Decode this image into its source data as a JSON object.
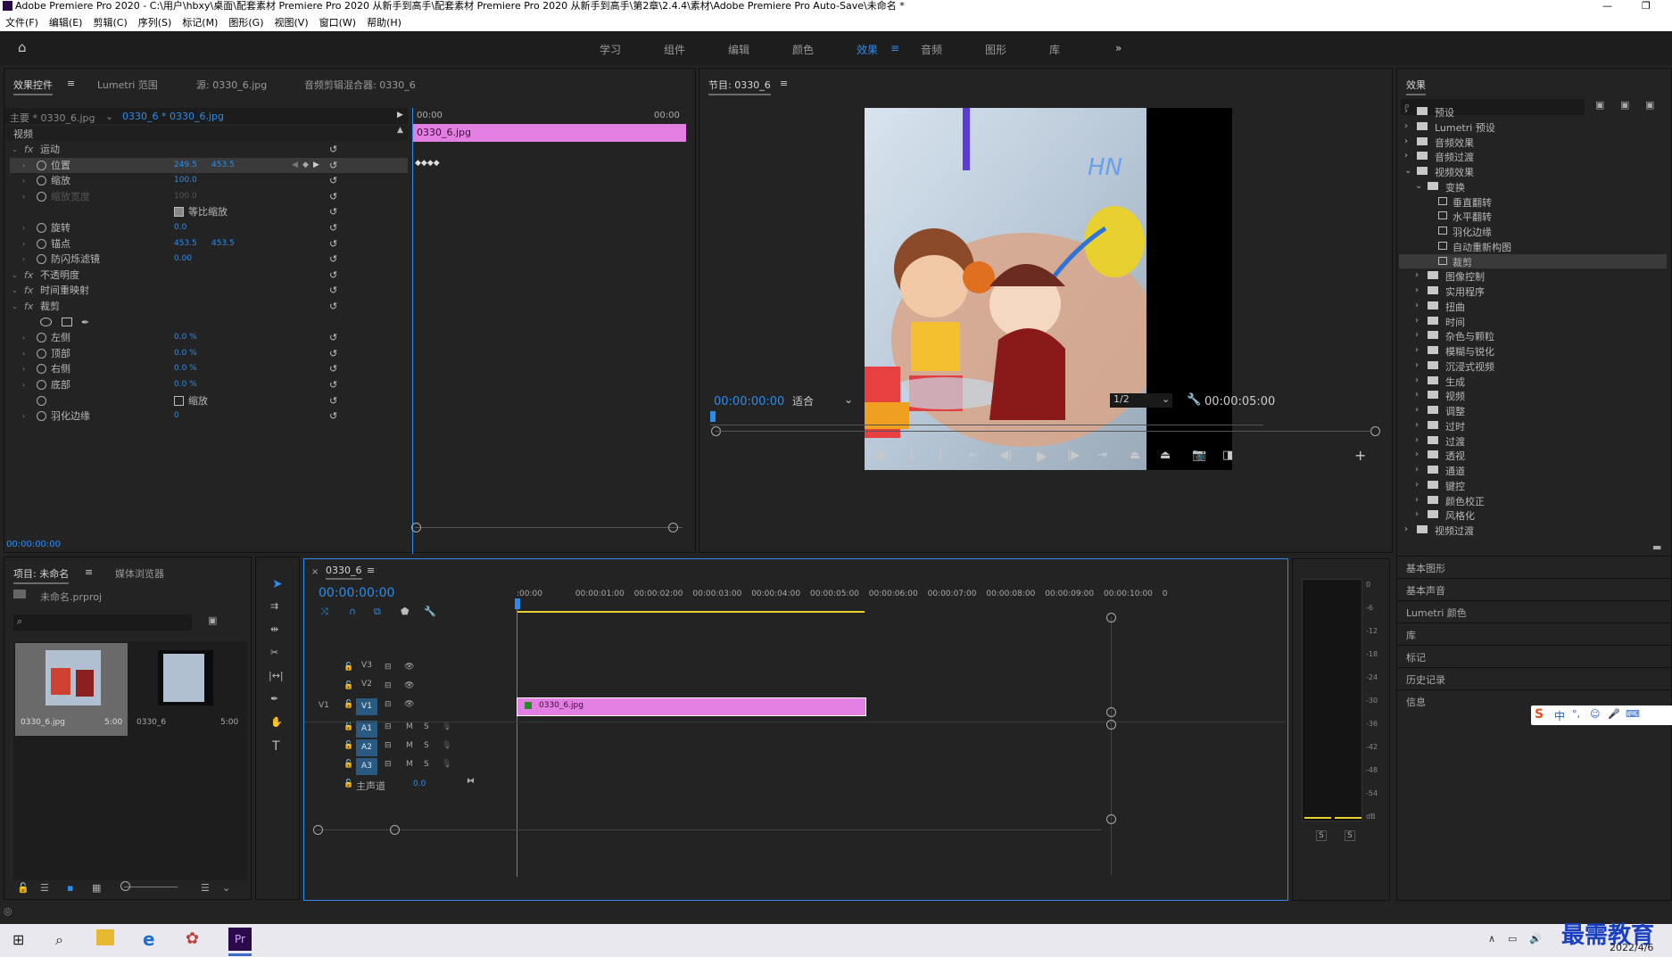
{
  "window": {
    "title": "Adobe Premiere Pro 2020 - C:\\用户\\hbxy\\桌面\\配套素材 Premiere Pro 2020 从新手到高手\\配套素材 Premiere Pro 2020 从新手到高手\\第2章\\2.4.4\\素材\\Adobe Premiere Pro Auto-Save\\未命名 *"
  },
  "menu": [
    "文件(F)",
    "编辑(E)",
    "剪辑(C)",
    "序列(S)",
    "标记(M)",
    "图形(G)",
    "视图(V)",
    "窗口(W)",
    "帮助(H)"
  ],
  "workspaces": [
    "学习",
    "组件",
    "编辑",
    "颜色",
    "效果",
    "音频",
    "图形",
    "库"
  ],
  "active_workspace": "效果",
  "effect_controls": {
    "tabs": [
      "效果控件",
      "Lumetri 范围",
      "源: 0330_6.jpg",
      "音频剪辑混合器: 0330_6"
    ],
    "master": "主要 * 0330_6.jpg",
    "clip": "0330_6 * 0330_6.jpg",
    "ruler_start": "00:00",
    "ruler_end": "00:00",
    "clip_bar": "0330_6.jpg",
    "video_label": "视频",
    "rows": [
      {
        "name": "运动",
        "type": "fx"
      },
      {
        "name": "位置",
        "v1": "249.5",
        "v2": "453.5",
        "selected": true
      },
      {
        "name": "缩放",
        "v1": "100.0"
      },
      {
        "name": "缩放宽度",
        "v1": "100.0",
        "disabled": true
      },
      {
        "name": "等比缩放",
        "type": "check"
      },
      {
        "name": "旋转",
        "v1": "0.0"
      },
      {
        "name": "锚点",
        "v1": "453.5",
        "v2": "453.5"
      },
      {
        "name": "防闪烁滤镜",
        "v1": "0.00"
      },
      {
        "name": "不透明度",
        "type": "fx"
      },
      {
        "name": "时间重映射",
        "type": "fx"
      },
      {
        "name": "裁剪",
        "type": "fx"
      },
      {
        "name": "",
        "type": "masks"
      },
      {
        "name": "左侧",
        "v1": "0.0 %"
      },
      {
        "name": "顶部",
        "v1": "0.0 %"
      },
      {
        "name": "右侧",
        "v1": "0.0 %"
      },
      {
        "name": "底部",
        "v1": "0.0 %"
      },
      {
        "name": "缩放",
        "type": "check2"
      },
      {
        "name": "羽化边缘",
        "v1": "0"
      }
    ],
    "timecode": "00:00:00:00"
  },
  "program": {
    "tab": "节目: 0330_6",
    "timecode": "00:00:00:00",
    "fit": "适合",
    "resolution": "1/2",
    "duration": "00:00:05:00"
  },
  "project": {
    "tabs": [
      "项目: 未命名",
      "媒体浏览器"
    ],
    "file": "未命名.prproj",
    "items": [
      {
        "name": "0330_6.jpg",
        "dur": "5:00"
      },
      {
        "name": "0330_6",
        "dur": "5:00"
      }
    ]
  },
  "timeline": {
    "tab": "0330_6",
    "timecode": "00:00:00:00",
    "ruler": [
      ":00:00",
      "00:00:01:00",
      "00:00:02:00",
      "00:00:03:00",
      "00:00:04:00",
      "00:00:05:00",
      "00:00:06:00",
      "00:00:07:00",
      "00:00:08:00",
      "00:00:09:00",
      "00:00:10:00",
      "0"
    ],
    "video_tracks": [
      "V3",
      "V2",
      "V1"
    ],
    "audio_tracks": [
      "A1",
      "A2",
      "A3"
    ],
    "source_track": "V1",
    "master": "主声道",
    "master_val": "0.0",
    "clip": "0330_6.jpg",
    "m": "M",
    "s": "S"
  },
  "meter": {
    "scale": [
      "0",
      "-6",
      "-12",
      "-18",
      "-24",
      "-30",
      "-36",
      "-42",
      "-48",
      "-54",
      "dB"
    ],
    "solo": [
      "S",
      "S"
    ]
  },
  "effects": {
    "title": "效果",
    "tree": [
      {
        "label": "预设",
        "level": 0,
        "open": false
      },
      {
        "label": "Lumetri 预设",
        "level": 0,
        "open": false
      },
      {
        "label": "音频效果",
        "level": 0,
        "open": false
      },
      {
        "label": "音频过渡",
        "level": 0,
        "open": false
      },
      {
        "label": "视频效果",
        "level": 0,
        "open": true
      },
      {
        "label": "变换",
        "level": 1,
        "open": true
      },
      {
        "label": "垂直翻转",
        "level": 2,
        "fx": true
      },
      {
        "label": "水平翻转",
        "level": 2,
        "fx": true
      },
      {
        "label": "羽化边缘",
        "level": 2,
        "fx": true
      },
      {
        "label": "自动重新构图",
        "level": 2,
        "fx": true
      },
      {
        "label": "裁剪",
        "level": 2,
        "fx": true,
        "selected": true
      },
      {
        "label": "图像控制",
        "level": 1
      },
      {
        "label": "实用程序",
        "level": 1
      },
      {
        "label": "扭曲",
        "level": 1
      },
      {
        "label": "时间",
        "level": 1
      },
      {
        "label": "杂色与颗粒",
        "level": 1
      },
      {
        "label": "模糊与锐化",
        "level": 1
      },
      {
        "label": "沉浸式视频",
        "level": 1
      },
      {
        "label": "生成",
        "level": 1
      },
      {
        "label": "视频",
        "level": 1
      },
      {
        "label": "调整",
        "level": 1
      },
      {
        "label": "过时",
        "level": 1
      },
      {
        "label": "过渡",
        "level": 1
      },
      {
        "label": "透视",
        "level": 1
      },
      {
        "label": "通道",
        "level": 1
      },
      {
        "label": "键控",
        "level": 1
      },
      {
        "label": "颜色校正",
        "level": 1
      },
      {
        "label": "风格化",
        "level": 1
      },
      {
        "label": "视频过渡",
        "level": 0
      }
    ],
    "side_panels": [
      "基本图形",
      "基本声音",
      "Lumetri 颜色",
      "库",
      "标记",
      "历史记录",
      "信息"
    ]
  },
  "taskbar": {
    "date": "2022/4/6",
    "watermark": "最需教育",
    "ime": "中"
  }
}
